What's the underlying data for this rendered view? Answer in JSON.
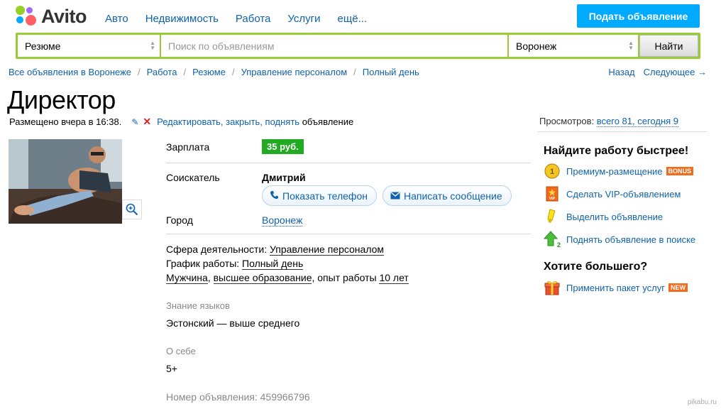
{
  "brand": {
    "name": "Avito"
  },
  "topnav": [
    "Авто",
    "Недвижимость",
    "Работа",
    "Услуги",
    "ещё..."
  ],
  "post_button": "Подать объявление",
  "search": {
    "category": "Резюме",
    "query_placeholder": "Поиск по объявлениям",
    "city": "Воронеж",
    "find_button": "Найти"
  },
  "breadcrumbs": [
    "Все объявления в Воронеже",
    "Работа",
    "Резюме",
    "Управление персоналом",
    "Полный день"
  ],
  "pager": {
    "back": "Назад",
    "next": "Следующее →"
  },
  "ad": {
    "title": "Директор",
    "posted": "Размещено вчера в 16:38.",
    "edit_links": "Редактировать, закрыть, поднять",
    "edit_suffix": "объявление",
    "views_label": "Просмотров:",
    "views_value": "всего 81, сегодня 9",
    "salary_label": "Зарплата",
    "salary_value": "35 руб.",
    "seeker_label": "Соискатель",
    "seeker_name": "Дмитрий",
    "show_phone": "Показать телефон",
    "write_message": "Написать сообщение",
    "city_label": "Город",
    "city_value": "Воронеж",
    "sphere_label": "Сфера деятельности:",
    "sphere_value": "Управление персоналом",
    "schedule_label": "График работы:",
    "schedule_value": "Полный день",
    "gender": "Мужчина",
    "education": "высшее образование",
    "experience_label": ", опыт работы",
    "experience_value": "10 лет",
    "languages_header": "Знание языков",
    "languages_value": "Эстонский — выше среднего",
    "about_header": "О себе",
    "about_value": "5+",
    "ad_number": "Номер объявления: 459966796"
  },
  "sidebar": {
    "heading1": "Найдите работу быстрее!",
    "items": [
      {
        "label": "Премиум-размещение",
        "badge": "BONUS",
        "icon": "coin-icon"
      },
      {
        "label": "Сделать VIP-объявлением",
        "badge": "",
        "icon": "vip-icon"
      },
      {
        "label": "Выделить объявление",
        "badge": "",
        "icon": "highlighter-icon"
      },
      {
        "label": "Поднять объявление в поиске",
        "badge": "",
        "icon": "up-arrow-icon"
      }
    ],
    "heading2": "Хотите большего?",
    "package": {
      "label": "Применить пакет услуг",
      "badge": "NEW",
      "icon": "gift-icon"
    }
  },
  "watermark": "pikabu.ru",
  "colors": {
    "brand_green": "#99cc33",
    "post_blue": "#00aaff",
    "link": "#0f62ad",
    "salary_green": "#22aa22",
    "badge_orange": "#f36b1c"
  }
}
